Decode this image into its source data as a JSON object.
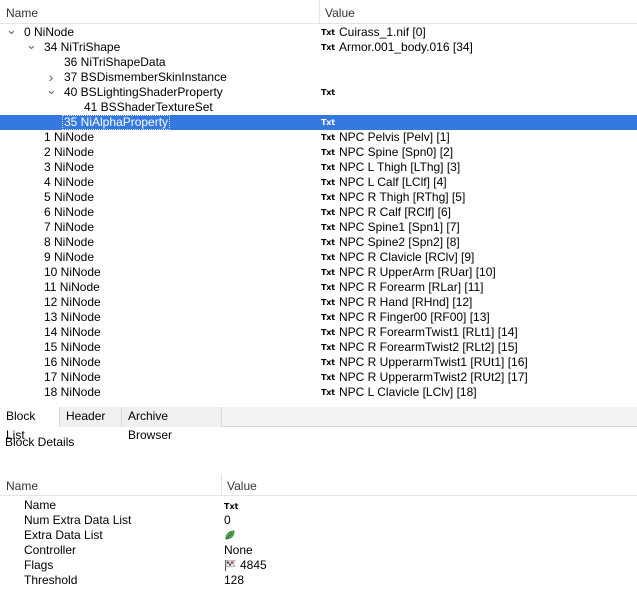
{
  "tree": {
    "headers": {
      "name": "Name",
      "value": "Value"
    },
    "rows": [
      {
        "name": "0 NiNode",
        "indent": 0,
        "arrow": "expanded",
        "value": "Cuirass_1.nif [0]",
        "has_txt": true
      },
      {
        "name": "34 NiTriShape",
        "indent": 1,
        "arrow": "expanded",
        "value": "Armor.001_body.016 [34]",
        "has_txt": true
      },
      {
        "name": "36 NiTriShapeData",
        "indent": 2,
        "arrow": "none",
        "value": "",
        "has_txt": false
      },
      {
        "name": "37 BSDismemberSkinInstance",
        "indent": 2,
        "arrow": "collapsed",
        "value": "",
        "has_txt": false
      },
      {
        "name": "40 BSLightingShaderProperty",
        "indent": 2,
        "arrow": "expanded",
        "value": "",
        "has_txt": true
      },
      {
        "name": "41 BSShaderTextureSet",
        "indent": 3,
        "arrow": "none",
        "value": "",
        "has_txt": false
      },
      {
        "name": "35 NiAlphaProperty",
        "indent": 2,
        "arrow": "none",
        "value": "",
        "has_txt": true,
        "selected": true
      },
      {
        "name": "1 NiNode",
        "indent": 1,
        "arrow": "none",
        "value": "NPC Pelvis [Pelv] [1]",
        "has_txt": true
      },
      {
        "name": "2 NiNode",
        "indent": 1,
        "arrow": "none",
        "value": "NPC Spine [Spn0] [2]",
        "has_txt": true
      },
      {
        "name": "3 NiNode",
        "indent": 1,
        "arrow": "none",
        "value": "NPC L Thigh [LThg] [3]",
        "has_txt": true
      },
      {
        "name": "4 NiNode",
        "indent": 1,
        "arrow": "none",
        "value": "NPC L Calf [LClf] [4]",
        "has_txt": true
      },
      {
        "name": "5 NiNode",
        "indent": 1,
        "arrow": "none",
        "value": "NPC R Thigh [RThg] [5]",
        "has_txt": true
      },
      {
        "name": "6 NiNode",
        "indent": 1,
        "arrow": "none",
        "value": "NPC R Calf [RClf] [6]",
        "has_txt": true
      },
      {
        "name": "7 NiNode",
        "indent": 1,
        "arrow": "none",
        "value": "NPC Spine1 [Spn1] [7]",
        "has_txt": true
      },
      {
        "name": "8 NiNode",
        "indent": 1,
        "arrow": "none",
        "value": "NPC Spine2 [Spn2] [8]",
        "has_txt": true
      },
      {
        "name": "9 NiNode",
        "indent": 1,
        "arrow": "none",
        "value": "NPC R Clavicle [RClv] [9]",
        "has_txt": true
      },
      {
        "name": "10 NiNode",
        "indent": 1,
        "arrow": "none",
        "value": "NPC R UpperArm [RUar] [10]",
        "has_txt": true
      },
      {
        "name": "11 NiNode",
        "indent": 1,
        "arrow": "none",
        "value": "NPC R Forearm [RLar] [11]",
        "has_txt": true
      },
      {
        "name": "12 NiNode",
        "indent": 1,
        "arrow": "none",
        "value": "NPC R Hand [RHnd] [12]",
        "has_txt": true
      },
      {
        "name": "13 NiNode",
        "indent": 1,
        "arrow": "none",
        "value": "NPC R Finger00 [RF00] [13]",
        "has_txt": true
      },
      {
        "name": "14 NiNode",
        "indent": 1,
        "arrow": "none",
        "value": "NPC R ForearmTwist1 [RLt1] [14]",
        "has_txt": true
      },
      {
        "name": "15 NiNode",
        "indent": 1,
        "arrow": "none",
        "value": "NPC R ForearmTwist2 [RLt2] [15]",
        "has_txt": true
      },
      {
        "name": "16 NiNode",
        "indent": 1,
        "arrow": "none",
        "value": "NPC R UpperarmTwist1 [RUt1] [16]",
        "has_txt": true
      },
      {
        "name": "17 NiNode",
        "indent": 1,
        "arrow": "none",
        "value": "NPC R UpperarmTwist2 [RUt2] [17]",
        "has_txt": true
      },
      {
        "name": "18 NiNode",
        "indent": 1,
        "arrow": "none",
        "value": "NPC L Clavicle [LClv] [18]",
        "has_txt": true
      }
    ],
    "txt_label": "Txt"
  },
  "tabs": {
    "items": [
      "Block List",
      "Header",
      "Archive Browser"
    ],
    "active": "Block List"
  },
  "details": {
    "title": "Block Details",
    "headers": {
      "name": "Name",
      "value": "Value"
    },
    "rows": [
      {
        "name": "Name",
        "value": "",
        "kind": "txt"
      },
      {
        "name": "Num Extra Data List",
        "value": "0",
        "kind": "text"
      },
      {
        "name": "Extra Data List",
        "value": "",
        "kind": "leaf-icon"
      },
      {
        "name": "Controller",
        "value": "None",
        "kind": "text"
      },
      {
        "name": "Flags",
        "value": "4845",
        "kind": "flag"
      },
      {
        "name": "Threshold",
        "value": "128",
        "kind": "text"
      }
    ]
  },
  "colors": {
    "selection": "#3478e0",
    "border": "#e5e5e5"
  }
}
